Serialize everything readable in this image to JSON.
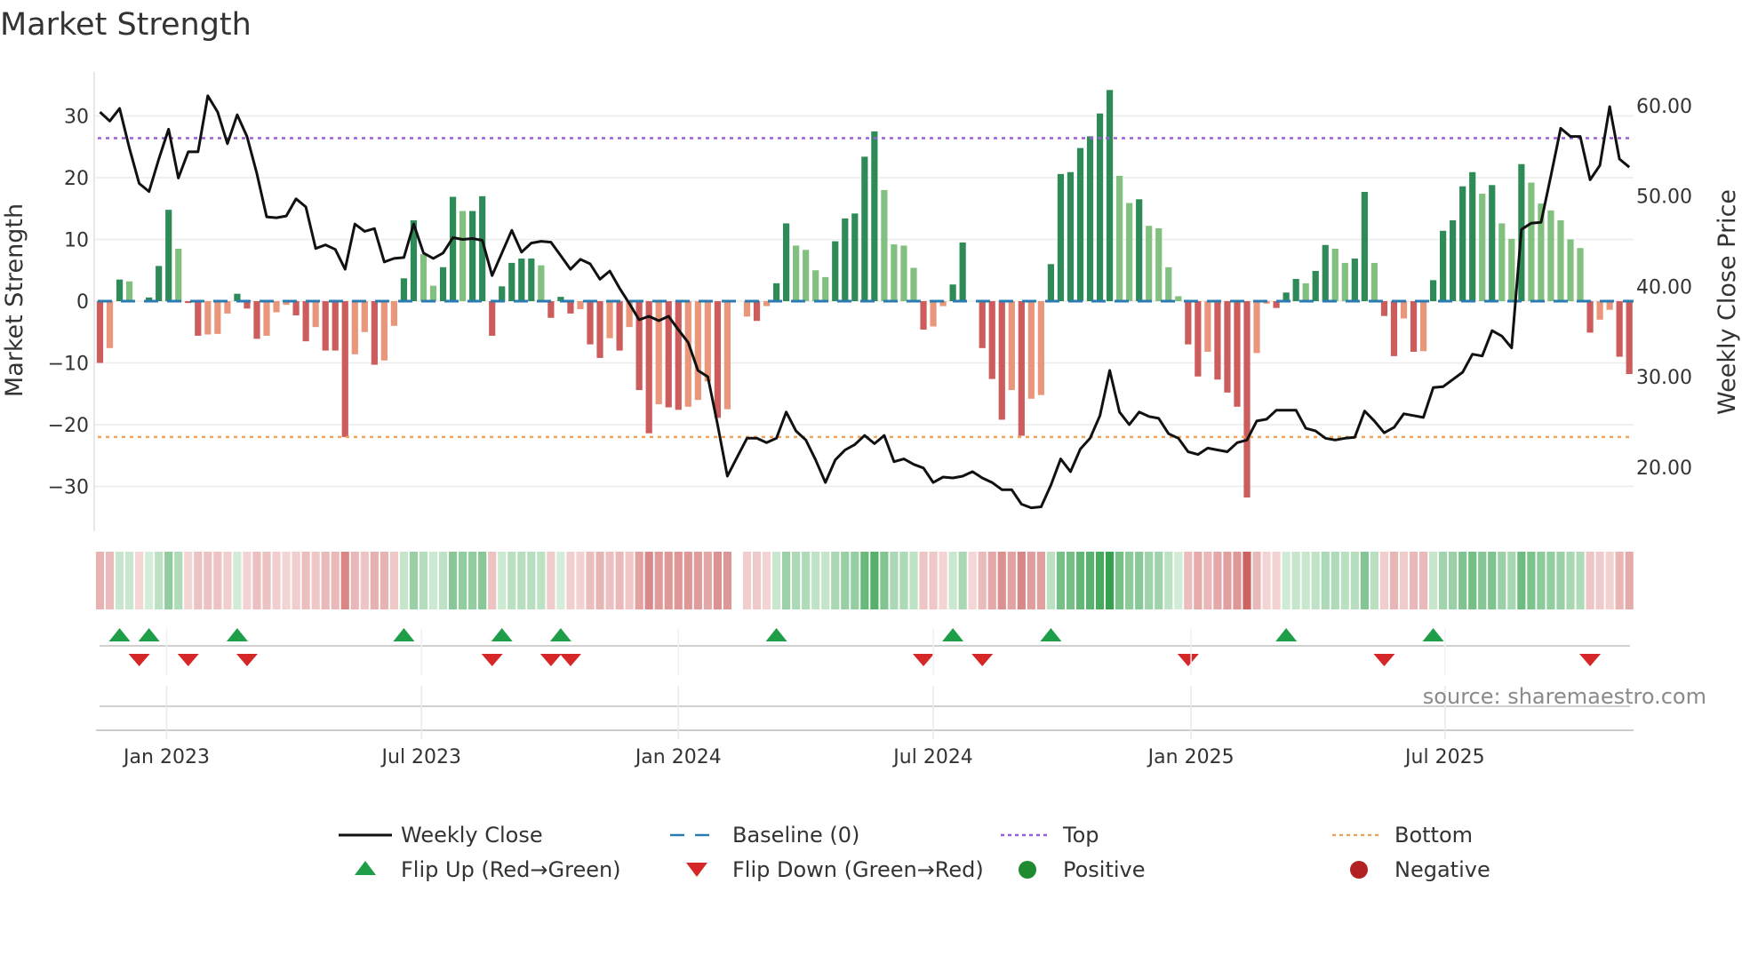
{
  "chart_data": {
    "type": "bar",
    "title": "Market Strength",
    "ylabel": "Market Strength",
    "y2label": "Weekly Close Price",
    "ylim": [
      -37,
      37
    ],
    "y2lim": [
      13.3,
      67.5
    ],
    "yticks": [
      30,
      20,
      10,
      0,
      -10,
      -20,
      -30
    ],
    "ytick_labels": [
      "30",
      "20",
      "10",
      "0",
      "−10",
      "−20",
      "−30"
    ],
    "y2ticks": [
      60,
      50,
      40,
      30,
      20
    ],
    "y2tick_labels": [
      "60.00",
      "50.00",
      "40.00",
      "30.00",
      "20.00"
    ],
    "xticks": [
      {
        "label": "Jan 2023",
        "week": 6.8
      },
      {
        "label": "Jul 2023",
        "week": 32.8
      },
      {
        "label": "Jan 2024",
        "week": 59.0
      },
      {
        "label": "Jul 2024",
        "week": 85.0
      },
      {
        "label": "Jan 2025",
        "week": 111.3
      },
      {
        "label": "Jul 2025",
        "week": 137.2
      }
    ],
    "top_level": 26.4,
    "bottom_level": -22,
    "baseline": 0,
    "strength": [
      -10,
      -7.6,
      3.5,
      3.2,
      0,
      0.6,
      5.7,
      14.8,
      8.5,
      -0.3,
      -5.6,
      -5.4,
      -5.3,
      -2,
      1.2,
      -1.2,
      -6.1,
      -5.6,
      -1.8,
      -0.6,
      -2.3,
      -6.5,
      -4.2,
      -8,
      -8,
      -22,
      -8.6,
      -5,
      -10.3,
      -9.6,
      -4,
      3.7,
      13.1,
      7.6,
      2.5,
      5.5,
      16.9,
      14.6,
      14.6,
      17,
      -5.6,
      2.4,
      6.2,
      6.9,
      6.9,
      5.8,
      -2.7,
      0.7,
      -2,
      -1.3,
      -7,
      -9.2,
      -6,
      -8,
      -4.2,
      -14.4,
      -21.4,
      -16.7,
      -17.2,
      -17.6,
      -17.1,
      -16,
      -13,
      -18.9,
      -17.5,
      null,
      -2.5,
      -3.2,
      -0.8,
      2.9,
      12.6,
      9,
      8.3,
      5,
      3.9,
      9.7,
      13.4,
      14.2,
      23.4,
      27.5,
      18,
      9.2,
      9,
      5.4,
      -4.6,
      -4.1,
      -0.8,
      2.7,
      9.5,
      0,
      -7.6,
      -12.6,
      -19.2,
      -14.4,
      -21.8,
      -15.8,
      -15.2,
      6,
      20.6,
      20.9,
      24.8,
      26.7,
      30.4,
      34.2,
      20.3,
      15.9,
      16.5,
      12.2,
      11.8,
      5.5,
      0.8,
      -7,
      -12.2,
      -8.2,
      -12.7,
      -14.8,
      -17.1,
      -31.8,
      -8.4,
      -0.4,
      -1.1,
      1.4,
      3.6,
      2.9,
      4.9,
      9.1,
      8.5,
      6.2,
      6.9,
      17.7,
      6.2,
      -2.4,
      -8.9,
      -2.8,
      -8.2,
      -8.1,
      3.4,
      11.4,
      13.1,
      18.6,
      20.9,
      17.4,
      18.8,
      12.6,
      10.1,
      22.2,
      19.2,
      15.8,
      14.7,
      13.1,
      10,
      8.6,
      -5.1,
      -3,
      -1.4,
      -9,
      -11.8
    ],
    "weekly_close": [
      59.3,
      58.3,
      59.7,
      55.3,
      51.4,
      50.5,
      54.1,
      57.4,
      52.0,
      54.9,
      54.9,
      61.1,
      59.3,
      55.8,
      59.0,
      56.6,
      52.5,
      47.7,
      47.6,
      47.8,
      49.7,
      48.8,
      44.2,
      44.6,
      44.1,
      41.9,
      46.9,
      46.1,
      46.4,
      42.7,
      43.1,
      43.2,
      46.9,
      43.7,
      43.1,
      43.7,
      45.4,
      45.2,
      45.3,
      45.1,
      41.2,
      43.7,
      46.2,
      43.8,
      44.8,
      45.0,
      44.9,
      43.4,
      41.9,
      43.0,
      42.5,
      40.8,
      41.7,
      39.8,
      38.1,
      36.3,
      36.7,
      36.2,
      36.7,
      35.2,
      33.8,
      30.7,
      30.0,
      24.7,
      19.0,
      21.1,
      23.2,
      23.2,
      22.7,
      23.2,
      26.1,
      24.0,
      23.0,
      20.8,
      18.3,
      20.8,
      21.9,
      22.5,
      23.5,
      22.6,
      23.5,
      20.6,
      20.9,
      20.3,
      19.9,
      18.3,
      18.9,
      18.8,
      19.0,
      19.5,
      18.8,
      18.3,
      17.5,
      17.5,
      15.9,
      15.5,
      15.6,
      18.0,
      20.9,
      19.5,
      22.0,
      23.2,
      25.7,
      30.7,
      26.1,
      24.7,
      26.1,
      25.6,
      25.4,
      23.7,
      23.2,
      21.7,
      21.4,
      22.1,
      21.9,
      21.7,
      22.7,
      23.0,
      25.1,
      25.3,
      26.3,
      26.3,
      26.3,
      24.3,
      24.0,
      23.2,
      23.0,
      23.2,
      23.3,
      26.2,
      25.1,
      23.8,
      24.4,
      25.9,
      25.7,
      25.5,
      28.8,
      28.9,
      29.7,
      30.5,
      32.5,
      32.3,
      35.1,
      34.5,
      33.2,
      46.3,
      47.0,
      47.1,
      52.2,
      57.5,
      56.6,
      56.6,
      51.8,
      53.4,
      59.9,
      54.1,
      53.2
    ],
    "flip_up_weeks": [
      2,
      5,
      14,
      31,
      41,
      47,
      69,
      87,
      97,
      121,
      136
    ],
    "flip_down_weeks": [
      4,
      9,
      15,
      40,
      46,
      48,
      84,
      90,
      111,
      131,
      152
    ],
    "legend": {
      "placement": "bottom-center",
      "entries": [
        {
          "key": "close",
          "label": "Weekly Close",
          "color": "#111111"
        },
        {
          "key": "baseline",
          "label": "Baseline (0)",
          "color": "#2b7bb0"
        },
        {
          "key": "top",
          "label": "Top",
          "color": "#9b5fd8"
        },
        {
          "key": "bottom",
          "label": "Bottom",
          "color": "#f0a35a"
        },
        {
          "key": "flip_up",
          "label": "Flip Up (Red→Green)",
          "color": "#1e9e48"
        },
        {
          "key": "flip_down",
          "label": "Flip Down (Green→Red)",
          "color": "#d62728"
        },
        {
          "key": "positive",
          "label": "Positive",
          "color": "#1f8a2e"
        },
        {
          "key": "negative",
          "label": "Negative",
          "color": "#b22222"
        }
      ]
    },
    "colors": {
      "pos_strong": "#2e8b57",
      "pos_weak": "#82c07f",
      "neg_strong": "#cd5c5c",
      "neg_weak": "#e9967a"
    },
    "source": "source: sharemaestro.com"
  }
}
